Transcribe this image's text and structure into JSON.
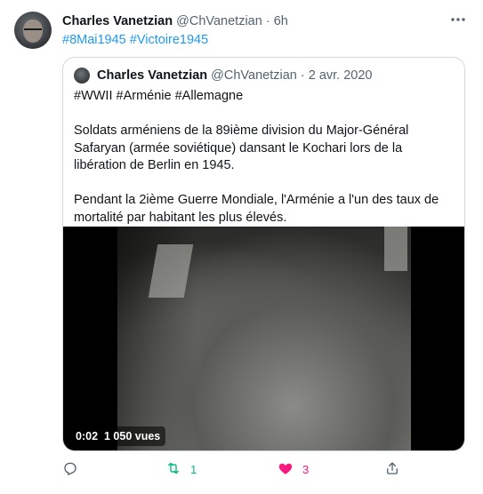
{
  "tweet": {
    "author_name": "Charles Vanetzian",
    "author_handle": "@ChVanetzian",
    "separator": "·",
    "time": "6h",
    "more_icon": "more-horizontal-icon",
    "hashtags": [
      "#8Mai1945",
      "#Victoire1945"
    ]
  },
  "quoted": {
    "author_name": "Charles Vanetzian",
    "author_handle": "@ChVanetzian",
    "separator": "·",
    "date": "2 avr. 2020",
    "paragraphs": [
      "#WWII #Arménie #Allemagne",
      "Soldats arméniens de la 89ième division du Major-Général Safaryan (armée soviétique)  dansant le Kochari lors de la libération de Berlin en 1945.",
      "Pendant la 2ième  Guerre Mondiale, l'Arménie a l'un des taux de mortalité par habitant les plus élevés."
    ],
    "video": {
      "time": "0:02",
      "views": "1 050 vues"
    }
  },
  "actions": {
    "reply": {
      "icon": "reply-icon",
      "count": ""
    },
    "retweet": {
      "icon": "retweet-icon",
      "count": "1",
      "color": "#00ba7c"
    },
    "like": {
      "icon": "heart-icon",
      "count": "3",
      "color": "#f91880"
    },
    "share": {
      "icon": "share-icon",
      "count": ""
    }
  },
  "colors": {
    "link": "#1d9bf0",
    "secondary_text": "#536471",
    "border": "#cfd9de"
  }
}
